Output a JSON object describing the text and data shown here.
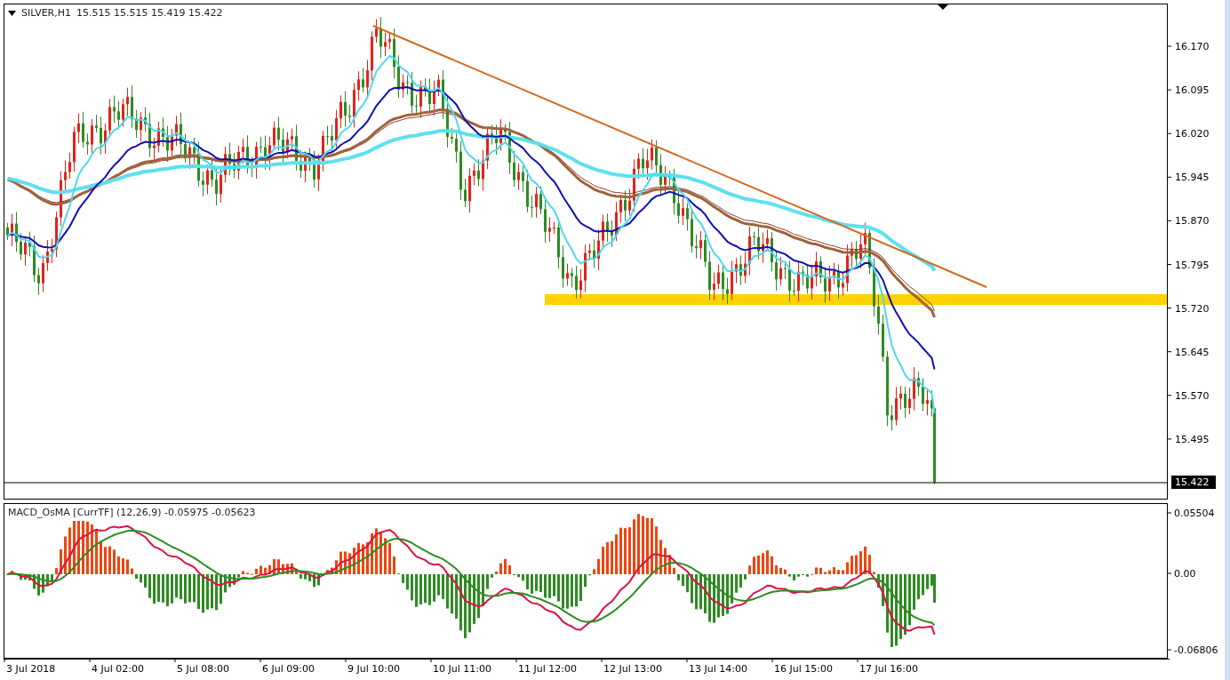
{
  "header": {
    "symbol": "SILVER,H1",
    "ohlc": "15.515 15.515 15.419 15.422"
  },
  "price_axis": {
    "ticks": [
      "16.170",
      "16.095",
      "16.020",
      "15.945",
      "15.870",
      "15.795",
      "15.720",
      "15.645",
      "15.570",
      "15.495"
    ],
    "current_price": "15.422"
  },
  "indicator": {
    "label": "MACD_OsMA [CurrTF] (12,26,9) -0.05975 -0.05623",
    "ticks": [
      "0.05504",
      "0.00",
      "-0.06806"
    ]
  },
  "time_axis": {
    "labels": [
      "3 Jul 2018",
      "4 Jul 02:00",
      "5 Jul 08:00",
      "6 Jul 09:00",
      "9 Jul 10:00",
      "10 Jul 11:00",
      "11 Jul 12:00",
      "12 Jul 13:00",
      "13 Jul 14:00",
      "16 Jul 15:00",
      "17 Jul 16:00"
    ]
  }
}
